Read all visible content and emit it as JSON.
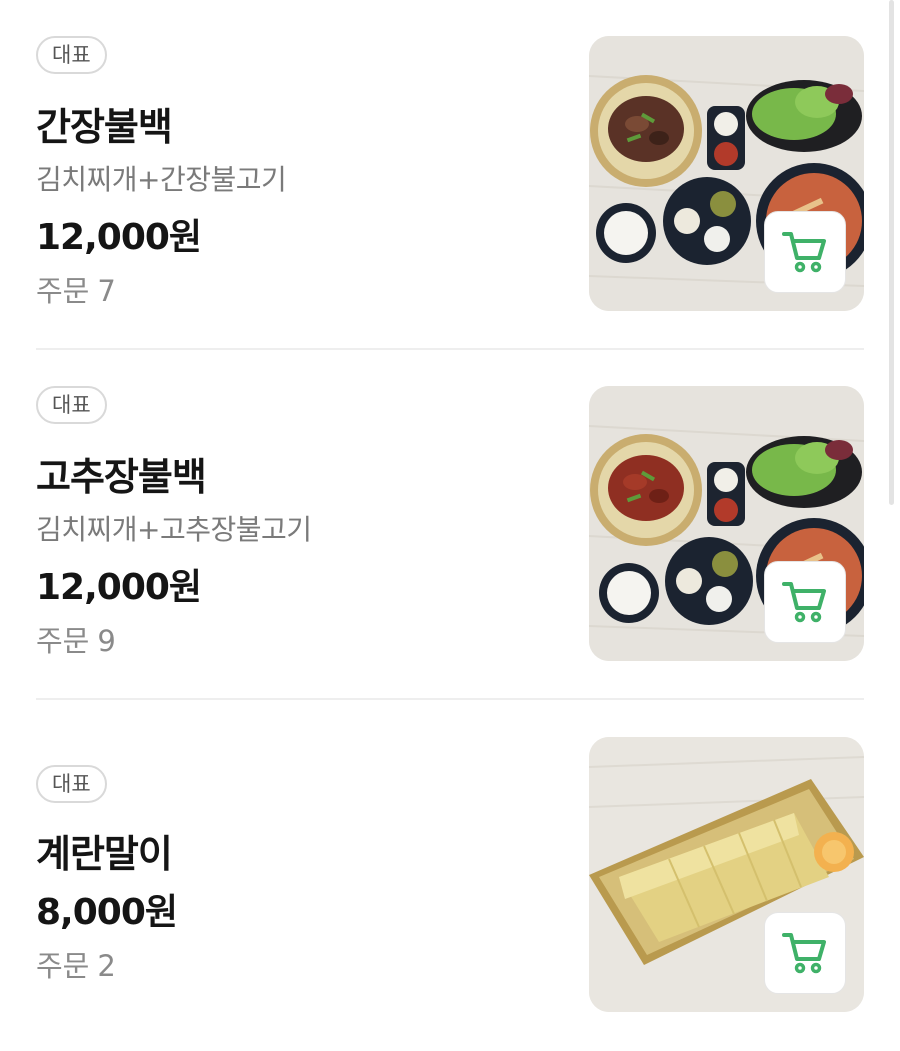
{
  "menu": {
    "items": [
      {
        "badge": "대표",
        "name": "간장불백",
        "description": "김치찌개+간장불고기",
        "price": "12,000원",
        "orders_label": "주문",
        "orders_count": "7",
        "image": "soy-bulgogi-set-photo",
        "cart_icon": "cart-icon"
      },
      {
        "badge": "대표",
        "name": "고추장불백",
        "description": "김치찌개+고추장불고기",
        "price": "12,000원",
        "orders_label": "주문",
        "orders_count": "9",
        "image": "gochujang-bulgogi-set-photo",
        "cart_icon": "cart-icon"
      },
      {
        "badge": "대표",
        "name": "계란말이",
        "price": "8,000원",
        "orders_label": "주문",
        "orders_count": "2",
        "image": "rolled-omelette-photo",
        "cart_icon": "cart-icon"
      }
    ]
  },
  "colors": {
    "cart_accent": "#3fb168",
    "badge_border": "#d9d9d9",
    "text_primary": "#151515",
    "text_secondary": "#7a7a7a"
  }
}
